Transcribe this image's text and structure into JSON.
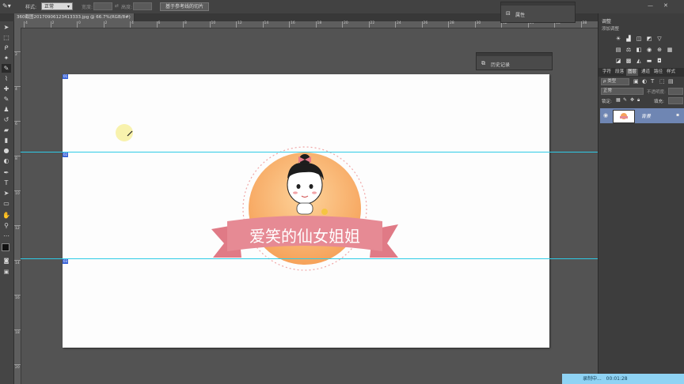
{
  "options_bar": {
    "style_label": "样式:",
    "style_value": "正常",
    "width_label": "宽度:",
    "height_label": "高度:",
    "slice_from_guides_button": "基于参考线的切片"
  },
  "document_tab": {
    "title": "360截图20170906123413333.jpg @ 66.7%(RGB/8#) *",
    "close": "×"
  },
  "properties_panel": {
    "title": "属性"
  },
  "history_panel": {
    "title": "历史记录"
  },
  "rulers": {
    "horizontal": [
      "4",
      "2",
      "0",
      "2",
      "4",
      "6",
      "8",
      "10",
      "12",
      "14",
      "16",
      "18",
      "20",
      "22",
      "24",
      "26",
      "28",
      "30",
      "32",
      "34",
      "36",
      "38"
    ],
    "vertical": [
      "2",
      "4",
      "6",
      "8",
      "10",
      "12",
      "14",
      "16",
      "18",
      "20"
    ]
  },
  "slices": [
    "01",
    "02",
    "03"
  ],
  "logo_text": "爱笑的仙女姐姐",
  "right_panel": {
    "adjustments_title": "调整",
    "add_adjustment_label": "添加调整",
    "tabs": [
      "字符",
      "段落",
      "图层",
      "通道",
      "路径",
      "样式"
    ],
    "active_tab": "图层",
    "kind_filter": "ρ 类型",
    "blend_mode": "正常",
    "opacity_label": "不透明度:",
    "lock_label": "锁定:",
    "fill_label": "填充:",
    "layer_name": "背景"
  },
  "recording": {
    "status": "录制中...",
    "time": "00:01:28"
  },
  "window": {
    "minimize": "—",
    "close": "✕"
  }
}
